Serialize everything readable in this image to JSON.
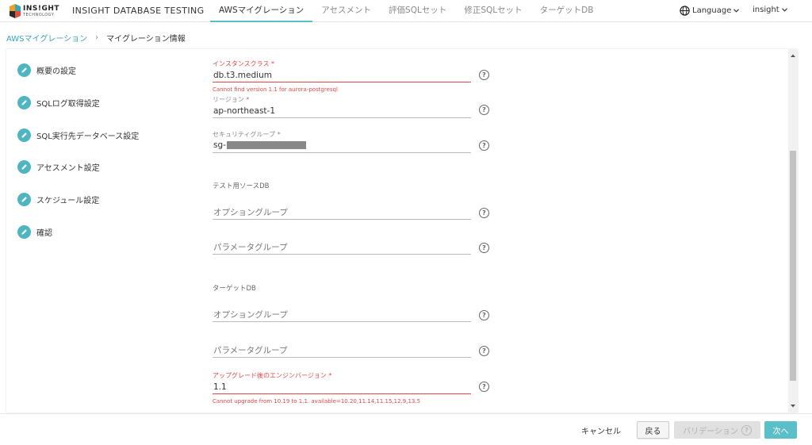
{
  "header": {
    "logo_text": "INS!GHT",
    "logo_sub": "TECHNOLOGY",
    "app_title": "INSIGHT DATABASE TESTING",
    "tabs": [
      {
        "label": "AWSマイグレーション",
        "active": true
      },
      {
        "label": "アセスメント",
        "active": false
      },
      {
        "label": "評価SQLセット",
        "active": false
      },
      {
        "label": "修正SQLセット",
        "active": false
      },
      {
        "label": "ターゲットDB",
        "active": false
      }
    ],
    "language_label": "Language",
    "user_label": "insight"
  },
  "breadcrumb": {
    "link": "AWSマイグレーション",
    "separator": "›",
    "current": "マイグレーション情報"
  },
  "steps": [
    {
      "label": "概要の設定"
    },
    {
      "label": "SQLログ取得設定"
    },
    {
      "label": "SQL実行先データベース設定"
    },
    {
      "label": "アセスメント設定"
    },
    {
      "label": "スケジュール設定"
    },
    {
      "label": "確認"
    }
  ],
  "form": {
    "instance_class": {
      "label": "インスタンスクラス *",
      "value": "db.t3.medium",
      "error": "Cannot find version 1.1 for aurora-postgresql"
    },
    "region": {
      "label": "リージョン *",
      "value": "ap-northeast-1"
    },
    "security_group": {
      "label": "セキュリティグループ *",
      "value_prefix": "sg-"
    },
    "test_source_db": {
      "title": "テスト用ソースDB",
      "option_group_placeholder": "オプショングループ",
      "parameter_group_placeholder": "パラメータグループ"
    },
    "target_db": {
      "title": "ターゲットDB",
      "option_group_placeholder": "オプショングループ",
      "parameter_group_placeholder": "パラメータグループ"
    },
    "engine_version": {
      "label": "アップグレード後のエンジンバージョン *",
      "value": "1.1",
      "error": "Cannot upgrade from 10.19 to 1.1. available=10.20,11.14,11.15,12.9,13.5"
    },
    "help_glyph": "?"
  },
  "footer": {
    "cancel_label": "キャンセル",
    "back_label": "戻る",
    "validate_label": "バリデーション",
    "next_label": "次へ"
  },
  "colors": {
    "accent": "#5bbfc9",
    "error": "#e04848",
    "step_icon": "#4fb5c1"
  },
  "icons": {
    "step": "pencil-icon",
    "help": "question-circle-icon",
    "language": "globe-icon",
    "dropdown": "chevron-down-icon"
  }
}
